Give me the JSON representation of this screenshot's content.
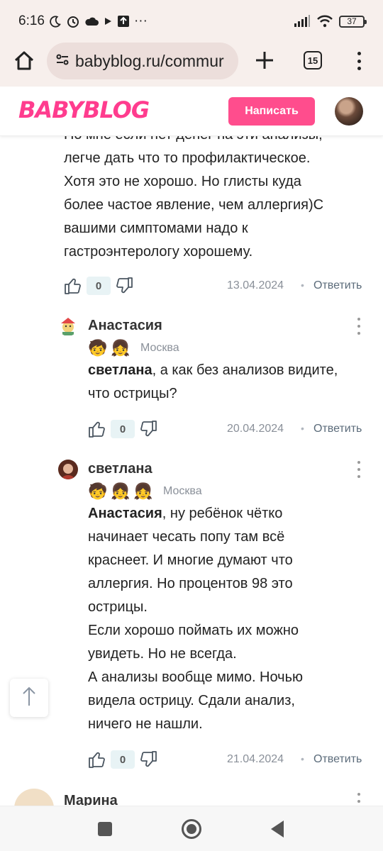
{
  "status_bar": {
    "time": "6:16",
    "dots": "···",
    "battery": "37"
  },
  "browser": {
    "url": "babyblog.ru/commur",
    "tab_count": "15"
  },
  "site_header": {
    "logo": "BABYBLOG",
    "write_button": "Написать"
  },
  "top_comment": {
    "text_lines": [
      "По мне если нет денег на эти анализы,",
      "легче дать что то профилактическое.",
      "Хотя это не хорошо. Но глисты куда",
      "более частое явление, чем аллергия)С",
      "вашими симптомами надо к",
      "гастроэнтерологу хорошему."
    ],
    "likes": "0",
    "date": "13.04.2024",
    "reply": "Ответить"
  },
  "replies": [
    {
      "name": "Анастасия",
      "city": "Москва",
      "kids": [
        "boy",
        "girl"
      ],
      "mention": "светлана",
      "text_after_mention": ", а как без анализов видите,",
      "text_lines": [
        "что острицы?"
      ],
      "likes": "0",
      "date": "20.04.2024",
      "reply": "Ответить"
    },
    {
      "name": "светлана",
      "city": "Москва",
      "kids": [
        "boy",
        "girl",
        "girl"
      ],
      "mention": "Анастасия",
      "text_after_mention": ", ну ребёнок чётко",
      "text_lines": [
        "начинает чесать попу там всё",
        "краснеет. И многие думают что",
        "аллергия. Но процентов 98 это",
        "острицы.",
        "Если хорошо поймать их можно",
        "увидеть. Но не всегда.",
        "А анализы вообще мимо. Ночью",
        "видела острицу. Сдали анализ,",
        "ничего не нашли."
      ],
      "likes": "0",
      "date": "21.04.2024",
      "reply": "Ответить"
    }
  ],
  "next_comment": {
    "name": "Марина"
  },
  "colors": {
    "brand_pink": "#ff4d8d",
    "chrome_bg": "#f7efec",
    "badge_bg": "#e8f3f5"
  }
}
